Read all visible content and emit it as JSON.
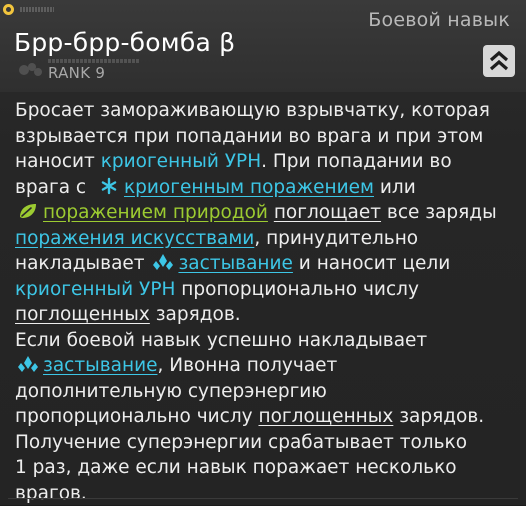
{
  "header": {
    "category": "Боевой навык",
    "title": "Брр-брр-бомба β",
    "rank": "RANK 9",
    "collapse_icon": "double-chevron-up-icon"
  },
  "description": {
    "l1": "Бросает замораживающую взрывчатку, которая",
    "l2": "взрывается при попадании во врага и при этом",
    "l3a": "наносит ",
    "l3b": "криогенный УРН",
    "l3c": ". При попадании во",
    "l4a": "врага с ",
    "l4b": "криогенным поражением",
    "l4c": " или",
    "l5a": "поражением природой",
    "l5b": " ",
    "l5c": "поглощает",
    "l5d": " все заряды",
    "l6a": "поражения искусствами",
    "l6b": ", принудительно",
    "l7a": "накладывает ",
    "l7b": "застывание",
    "l7c": " и наносит цели",
    "l8a": "криогенный УРН",
    "l8b": " пропорционально числу",
    "l9a": "поглощенных",
    "l9b": " зарядов.",
    "l10": "Если боевой навык успешно накладывает",
    "l11a": "застывание",
    "l11b": ", Ивонна получает",
    "l12": "дополнительную суперэнергию",
    "l13a": "пропорционально числу ",
    "l13b": "поглощенных",
    "l13c": " зарядов.",
    "l14": "Получение суперэнергии срабатывает только",
    "l15": "1 раз, даже если навык поражает несколько",
    "l16": "врагов."
  },
  "icons": {
    "cryo": "snowflake-icon",
    "nature": "leaf-icon",
    "solidify": "crystal-icon"
  },
  "colors": {
    "cryo": "#3dc6e6",
    "nature": "#9ccb31",
    "accent": "#f2c53d"
  }
}
